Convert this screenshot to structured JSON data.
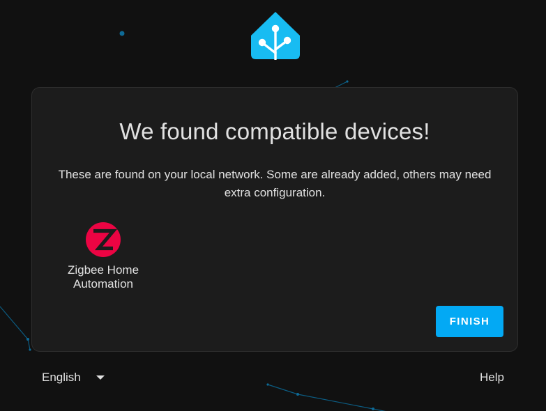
{
  "colors": {
    "background": "#111111",
    "card": "#1c1c1c",
    "accent": "#03a9f4",
    "brand_logo": "#18bcf2",
    "zigbee_red": "#eb0443",
    "text": "#e1e1e1",
    "network_lines": "#0c5c82"
  },
  "header": {
    "logo_icon": "home-assistant-logo-icon"
  },
  "card": {
    "title": "We found compatible devices!",
    "description": "These are found on your local network. Some are already added, others may need extra configuration.",
    "devices": [
      {
        "label": "Zigbee Home Automation",
        "icon": "zigbee-logo-icon"
      }
    ],
    "finish_label": "FINISH"
  },
  "footer": {
    "language": {
      "selected": "English",
      "icon": "chevron-down-icon"
    },
    "help_label": "Help"
  }
}
